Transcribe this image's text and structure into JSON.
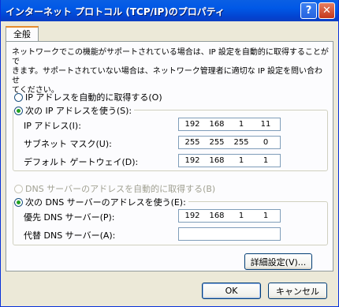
{
  "window": {
    "title": "インターネット プロトコル (TCP/IP)のプロパティ",
    "help_label": "?",
    "close_label": "✕"
  },
  "tab": {
    "label": "全般"
  },
  "description": "ネットワークでこの機能がサポートされている場合は、IP 設定を自動的に取得することがで\nきます。サポートされていない場合は、ネットワーク管理者に適切な IP 設定を問い合わせ\nてください。",
  "ip_mode": {
    "auto_label": "IP アドレスを自動的に取得する(O)",
    "manual_label": "次の IP アドレスを使う(S):",
    "selected": "manual"
  },
  "ip_fields": [
    {
      "label": "IP アドレス(I):",
      "octets": [
        "192",
        "168",
        "1",
        "11"
      ]
    },
    {
      "label": "サブネット マスク(U):",
      "octets": [
        "255",
        "255",
        "255",
        "0"
      ]
    },
    {
      "label": "デフォルト ゲートウェイ(D):",
      "octets": [
        "192",
        "168",
        "1",
        "1"
      ]
    }
  ],
  "dns_mode": {
    "auto_label": "DNS サーバーのアドレスを自動的に取得する(B)",
    "manual_label": "次の DNS サーバーのアドレスを使う(E):",
    "selected": "manual"
  },
  "dns_fields": [
    {
      "label": "優先 DNS サーバー(P):",
      "octets": [
        "192",
        "168",
        "1",
        "1"
      ]
    },
    {
      "label": "代替 DNS サーバー(A):",
      "octets": [
        "",
        "",
        "",
        ""
      ]
    }
  ],
  "buttons": {
    "advanced": "詳細設定(V)...",
    "ok": "OK",
    "cancel": "キャンセル"
  },
  "colors": {
    "titlebar": "#0058e6",
    "tab_accent": "#e68b2c",
    "radio_selected": "#21a121",
    "dialog_bg": "#ece9d8"
  }
}
